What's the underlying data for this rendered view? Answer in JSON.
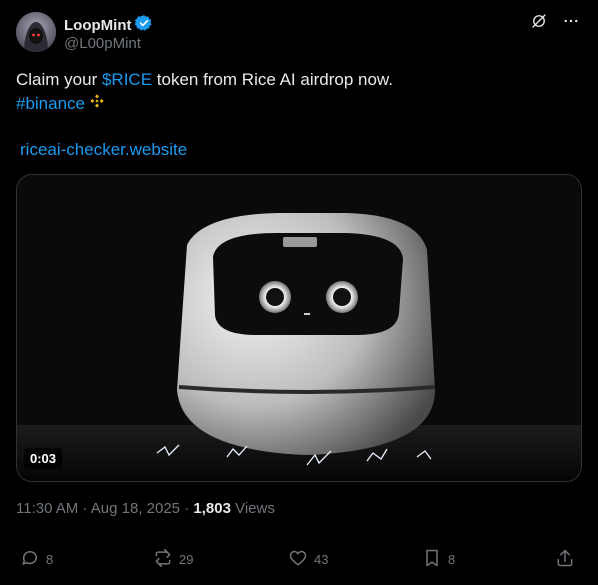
{
  "author": {
    "name": "LoopMint",
    "handle": "@L00pMint",
    "verified": true,
    "verified_color": "#1d9bf0"
  },
  "tweet": {
    "text_prefix": "Claim your ",
    "cashtag": "$RICE",
    "text_suffix": " token from Rice AI airdrop now.",
    "hashtag": "#binance",
    "hashtag_emoji": "binance-logo-icon",
    "link": "riceai-checker.website"
  },
  "media": {
    "duration": "0:03",
    "subject": "robot-video-thumbnail"
  },
  "meta": {
    "time": "11:30 AM",
    "date": "Aug 18, 2025",
    "views_count": "1,803",
    "views_label": "Views",
    "sep": "·"
  },
  "actions": {
    "replies": "8",
    "reposts": "29",
    "likes": "43",
    "bookmarks": "8"
  },
  "colors": {
    "background": "#000000",
    "text": "#e7e9ea",
    "secondary": "#71767b",
    "accent": "#1d9bf0",
    "binance": "#f0b90b"
  }
}
